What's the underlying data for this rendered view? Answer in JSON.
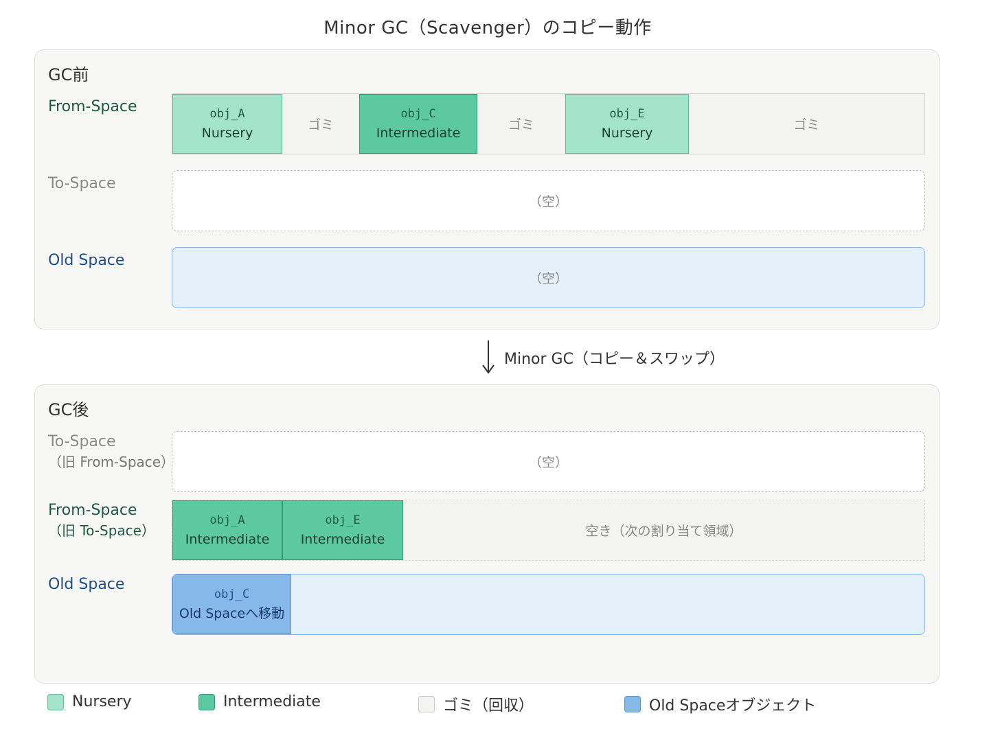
{
  "title": "Minor GC（Scavenger）のコピー動作",
  "colors": {
    "nursery": "#a3e3c9",
    "intermediate": "#5cc9a2",
    "garbage": "#f3f3f1",
    "old_object": "#86b8ea",
    "old_space_bg": "#e4f0fa"
  },
  "before": {
    "title": "GC前",
    "from_space": {
      "label": "From-Space",
      "segments": [
        {
          "name": "obj_A",
          "kind": "Nursery"
        },
        {
          "text": "ゴミ"
        },
        {
          "name": "obj_C",
          "kind": "Intermediate"
        },
        {
          "text": "ゴミ"
        },
        {
          "name": "obj_E",
          "kind": "Nursery"
        },
        {
          "text": "ゴミ"
        }
      ]
    },
    "to_space": {
      "label": "To-Space",
      "content": "（空）"
    },
    "old_space": {
      "label": "Old Space",
      "content": "（空）"
    }
  },
  "arrow": {
    "label": "Minor GC（コピー＆スワップ）",
    "icon": "down-arrow-icon"
  },
  "after": {
    "title": "GC後",
    "to_space": {
      "label": "To-Space",
      "sub": "（旧 From-Space）",
      "content": "（空）"
    },
    "from_space": {
      "label": "From-Space",
      "sub": "（旧 To-Space）",
      "segments": [
        {
          "name": "obj_A",
          "kind": "Intermediate"
        },
        {
          "name": "obj_E",
          "kind": "Intermediate"
        },
        {
          "text": "空き（次の割り当て領域）"
        }
      ]
    },
    "old_space": {
      "label": "Old Space",
      "segments": [
        {
          "name": "obj_C",
          "kind": "Old Spaceへ移動"
        }
      ]
    }
  },
  "legend": [
    {
      "label": "Nursery"
    },
    {
      "label": "Intermediate"
    },
    {
      "label": "ゴミ（回収）"
    },
    {
      "label": "Old Spaceオブジェクト"
    }
  ]
}
